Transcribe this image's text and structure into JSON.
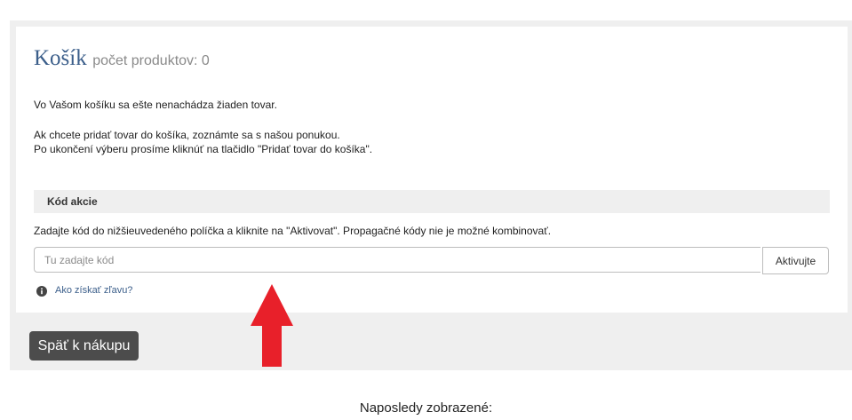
{
  "cart": {
    "title": "Košík",
    "count_label": "počet produktov: 0",
    "empty_message": "Vo Vašom košíku sa ešte nenachádza žiaden tovar.",
    "hint_line1": "Ak chcete pridať tovar do košíka, zoznámte sa s našou ponukou.",
    "hint_line2": "Po ukončení výberu prosíme kliknúť na tlačidlo \"Pridať tovar do košíka\"."
  },
  "promo": {
    "header": "Kód akcie",
    "instructions": "Zadajte kód do nižšieuvedeného políčka a kliknite na \"Aktivovat\". Propagačné kódy nie je možné kombinovať.",
    "input_value": "",
    "placeholder": "Tu zadajte kód",
    "activate_label": "Aktivujte",
    "discount_link": "Ako získať zľavu?"
  },
  "back_button": "Späť k nákupu",
  "recently_viewed": "Naposledy zobrazené:",
  "colors": {
    "title": "#3b5e8a",
    "arrow": "#e8202a",
    "back_button_bg": "#4c4c4c"
  },
  "icons": {
    "info": "info-circle-icon",
    "annotation": "red-up-arrow-icon"
  }
}
